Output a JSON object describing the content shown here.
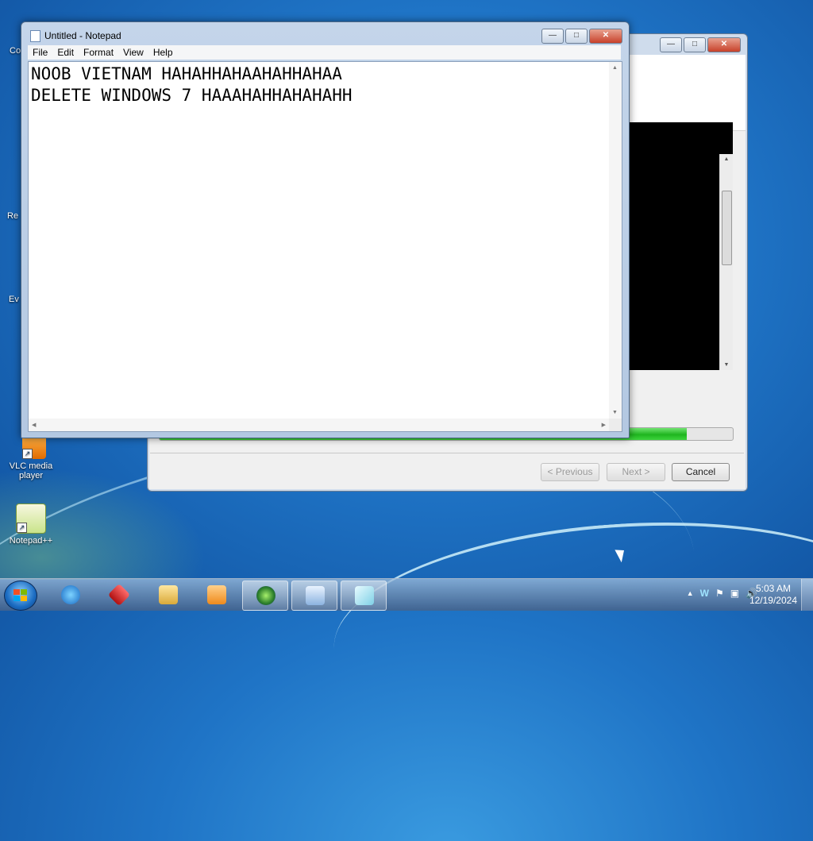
{
  "notepad": {
    "title": "Untitled - Notepad",
    "menu": [
      "File",
      "Edit",
      "Format",
      "View",
      "Help"
    ],
    "content_line1": "NOOB VIETNAM HAHAHHAHAAHAHHAHAA",
    "content_line2": "DELETE WINDOWS 7 HAAAHAHHAHAHAHH",
    "window_buttons": {
      "minimize": "—",
      "maximize": "□",
      "close": "✕"
    }
  },
  "installer": {
    "progress_fraction": 0.92,
    "previous_label": "< Previous",
    "next_label": "Next >",
    "cancel_label": "Cancel",
    "progress_color": "#1fb51f"
  },
  "desktop": {
    "icons": [
      {
        "label": "VLC media player",
        "icon": "vlc-icon"
      },
      {
        "label": "Notepad++",
        "icon": "notepadpp-icon"
      }
    ],
    "partial_labels": [
      "Co",
      "Re",
      "Ev"
    ]
  },
  "taskbar": {
    "apps": [
      "internet-explorer-icon",
      "media-icon",
      "explorer-icon",
      "media-player-icon",
      "installer-icon",
      "display-icon",
      "notepad-icon"
    ],
    "clock_time": "5:03 AM",
    "clock_date": "12/19/2024",
    "tray_icons": [
      "show-hidden-icon",
      "network-app-icon",
      "flag-icon",
      "network-icon",
      "volume-icon"
    ],
    "tray_glyphs": [
      "▲",
      "W",
      "⚑",
      "▣",
      "🔊"
    ]
  }
}
